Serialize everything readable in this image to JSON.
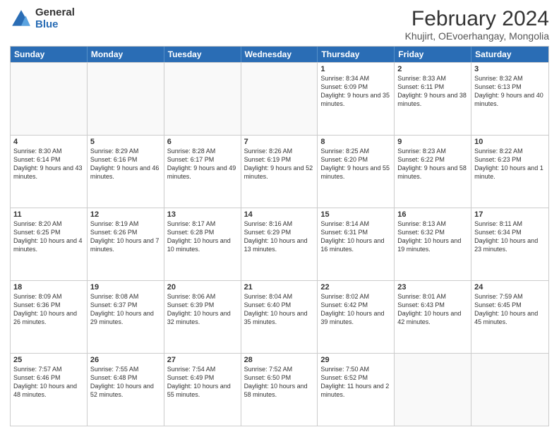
{
  "header": {
    "logo_general": "General",
    "logo_blue": "Blue",
    "title": "February 2024",
    "subtitle": "Khujirt, OEvoerhangay, Mongolia"
  },
  "days": [
    "Sunday",
    "Monday",
    "Tuesday",
    "Wednesday",
    "Thursday",
    "Friday",
    "Saturday"
  ],
  "weeks": [
    [
      {
        "day": "",
        "empty": true
      },
      {
        "day": "",
        "empty": true
      },
      {
        "day": "",
        "empty": true
      },
      {
        "day": "",
        "empty": true
      },
      {
        "day": "1",
        "sunrise": "8:34 AM",
        "sunset": "6:09 PM",
        "daylight": "9 hours and 35 minutes."
      },
      {
        "day": "2",
        "sunrise": "8:33 AM",
        "sunset": "6:11 PM",
        "daylight": "9 hours and 38 minutes."
      },
      {
        "day": "3",
        "sunrise": "8:32 AM",
        "sunset": "6:13 PM",
        "daylight": "9 hours and 40 minutes."
      }
    ],
    [
      {
        "day": "4",
        "sunrise": "8:30 AM",
        "sunset": "6:14 PM",
        "daylight": "9 hours and 43 minutes."
      },
      {
        "day": "5",
        "sunrise": "8:29 AM",
        "sunset": "6:16 PM",
        "daylight": "9 hours and 46 minutes."
      },
      {
        "day": "6",
        "sunrise": "8:28 AM",
        "sunset": "6:17 PM",
        "daylight": "9 hours and 49 minutes."
      },
      {
        "day": "7",
        "sunrise": "8:26 AM",
        "sunset": "6:19 PM",
        "daylight": "9 hours and 52 minutes."
      },
      {
        "day": "8",
        "sunrise": "8:25 AM",
        "sunset": "6:20 PM",
        "daylight": "9 hours and 55 minutes."
      },
      {
        "day": "9",
        "sunrise": "8:23 AM",
        "sunset": "6:22 PM",
        "daylight": "9 hours and 58 minutes."
      },
      {
        "day": "10",
        "sunrise": "8:22 AM",
        "sunset": "6:23 PM",
        "daylight": "10 hours and 1 minute."
      }
    ],
    [
      {
        "day": "11",
        "sunrise": "8:20 AM",
        "sunset": "6:25 PM",
        "daylight": "10 hours and 4 minutes."
      },
      {
        "day": "12",
        "sunrise": "8:19 AM",
        "sunset": "6:26 PM",
        "daylight": "10 hours and 7 minutes."
      },
      {
        "day": "13",
        "sunrise": "8:17 AM",
        "sunset": "6:28 PM",
        "daylight": "10 hours and 10 minutes."
      },
      {
        "day": "14",
        "sunrise": "8:16 AM",
        "sunset": "6:29 PM",
        "daylight": "10 hours and 13 minutes."
      },
      {
        "day": "15",
        "sunrise": "8:14 AM",
        "sunset": "6:31 PM",
        "daylight": "10 hours and 16 minutes."
      },
      {
        "day": "16",
        "sunrise": "8:13 AM",
        "sunset": "6:32 PM",
        "daylight": "10 hours and 19 minutes."
      },
      {
        "day": "17",
        "sunrise": "8:11 AM",
        "sunset": "6:34 PM",
        "daylight": "10 hours and 23 minutes."
      }
    ],
    [
      {
        "day": "18",
        "sunrise": "8:09 AM",
        "sunset": "6:36 PM",
        "daylight": "10 hours and 26 minutes."
      },
      {
        "day": "19",
        "sunrise": "8:08 AM",
        "sunset": "6:37 PM",
        "daylight": "10 hours and 29 minutes."
      },
      {
        "day": "20",
        "sunrise": "8:06 AM",
        "sunset": "6:39 PM",
        "daylight": "10 hours and 32 minutes."
      },
      {
        "day": "21",
        "sunrise": "8:04 AM",
        "sunset": "6:40 PM",
        "daylight": "10 hours and 35 minutes."
      },
      {
        "day": "22",
        "sunrise": "8:02 AM",
        "sunset": "6:42 PM",
        "daylight": "10 hours and 39 minutes."
      },
      {
        "day": "23",
        "sunrise": "8:01 AM",
        "sunset": "6:43 PM",
        "daylight": "10 hours and 42 minutes."
      },
      {
        "day": "24",
        "sunrise": "7:59 AM",
        "sunset": "6:45 PM",
        "daylight": "10 hours and 45 minutes."
      }
    ],
    [
      {
        "day": "25",
        "sunrise": "7:57 AM",
        "sunset": "6:46 PM",
        "daylight": "10 hours and 48 minutes."
      },
      {
        "day": "26",
        "sunrise": "7:55 AM",
        "sunset": "6:48 PM",
        "daylight": "10 hours and 52 minutes."
      },
      {
        "day": "27",
        "sunrise": "7:54 AM",
        "sunset": "6:49 PM",
        "daylight": "10 hours and 55 minutes."
      },
      {
        "day": "28",
        "sunrise": "7:52 AM",
        "sunset": "6:50 PM",
        "daylight": "10 hours and 58 minutes."
      },
      {
        "day": "29",
        "sunrise": "7:50 AM",
        "sunset": "6:52 PM",
        "daylight": "11 hours and 2 minutes."
      },
      {
        "day": "",
        "empty": true
      },
      {
        "day": "",
        "empty": true
      }
    ]
  ]
}
